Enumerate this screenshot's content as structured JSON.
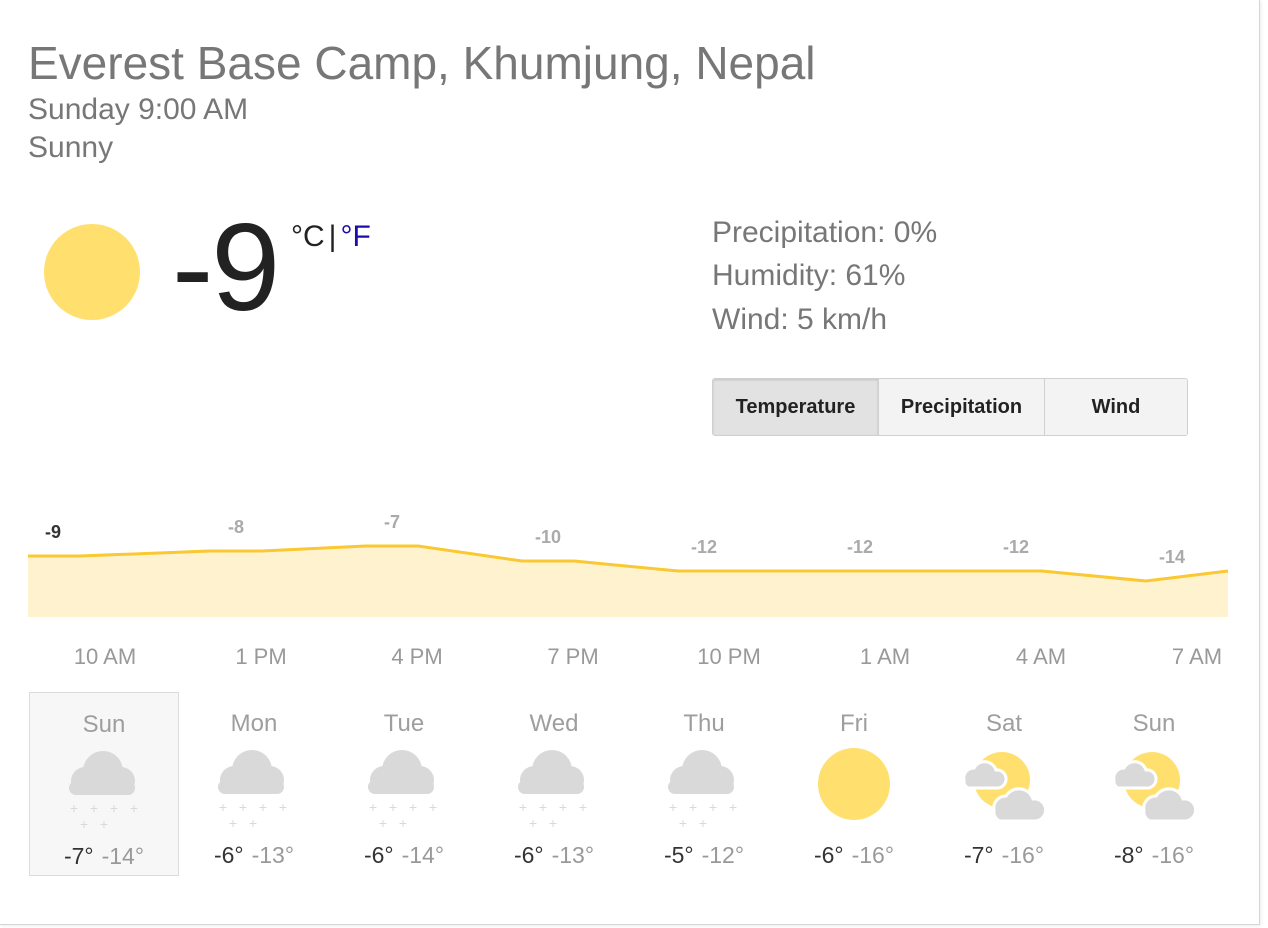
{
  "location": "Everest Base Camp, Khumjung, Nepal",
  "time": "Sunday 9:00 AM",
  "condition": "Sunny",
  "current": {
    "temp": "-9",
    "unit_c": "°C",
    "separator": "|",
    "unit_f": "°F",
    "icon": "sun-icon"
  },
  "stats": {
    "precipitation": "Precipitation: 0%",
    "humidity": "Humidity: 61%",
    "wind": "Wind: 5 km/h"
  },
  "tabs": [
    {
      "label": "Temperature",
      "active": true
    },
    {
      "label": "Precipitation",
      "active": false
    },
    {
      "label": "Wind",
      "active": false
    }
  ],
  "chart_data": {
    "type": "area",
    "series": [
      {
        "values": [
          -9,
          -8,
          -7,
          -10,
          -12,
          -12,
          -12,
          -14
        ]
      }
    ],
    "x": [
      "10 AM",
      "1 PM",
      "4 PM",
      "7 PM",
      "10 PM",
      "1 AM",
      "4 AM",
      "7 AM"
    ],
    "line_color": "#f9c832",
    "fill_color": "#fff3cf"
  },
  "days": [
    {
      "name": "Sun",
      "high": "-7°",
      "low": "-14°",
      "icon": "snow-cloud-icon",
      "selected": true
    },
    {
      "name": "Mon",
      "high": "-6°",
      "low": "-13°",
      "icon": "snow-cloud-icon",
      "selected": false
    },
    {
      "name": "Tue",
      "high": "-6°",
      "low": "-14°",
      "icon": "snow-cloud-icon",
      "selected": false
    },
    {
      "name": "Wed",
      "high": "-6°",
      "low": "-13°",
      "icon": "snow-cloud-icon",
      "selected": false
    },
    {
      "name": "Thu",
      "high": "-5°",
      "low": "-12°",
      "icon": "snow-cloud-icon",
      "selected": false
    },
    {
      "name": "Fri",
      "high": "-6°",
      "low": "-16°",
      "icon": "sun-icon",
      "selected": false
    },
    {
      "name": "Sat",
      "high": "-7°",
      "low": "-16°",
      "icon": "partly-cloudy-icon",
      "selected": false
    },
    {
      "name": "Sun",
      "high": "-8°",
      "low": "-16°",
      "icon": "partly-cloudy-icon",
      "selected": false
    }
  ],
  "colors": {
    "sun": "#ffe06e",
    "cloud": "#d9d9d9",
    "link": "#1a0dab"
  }
}
